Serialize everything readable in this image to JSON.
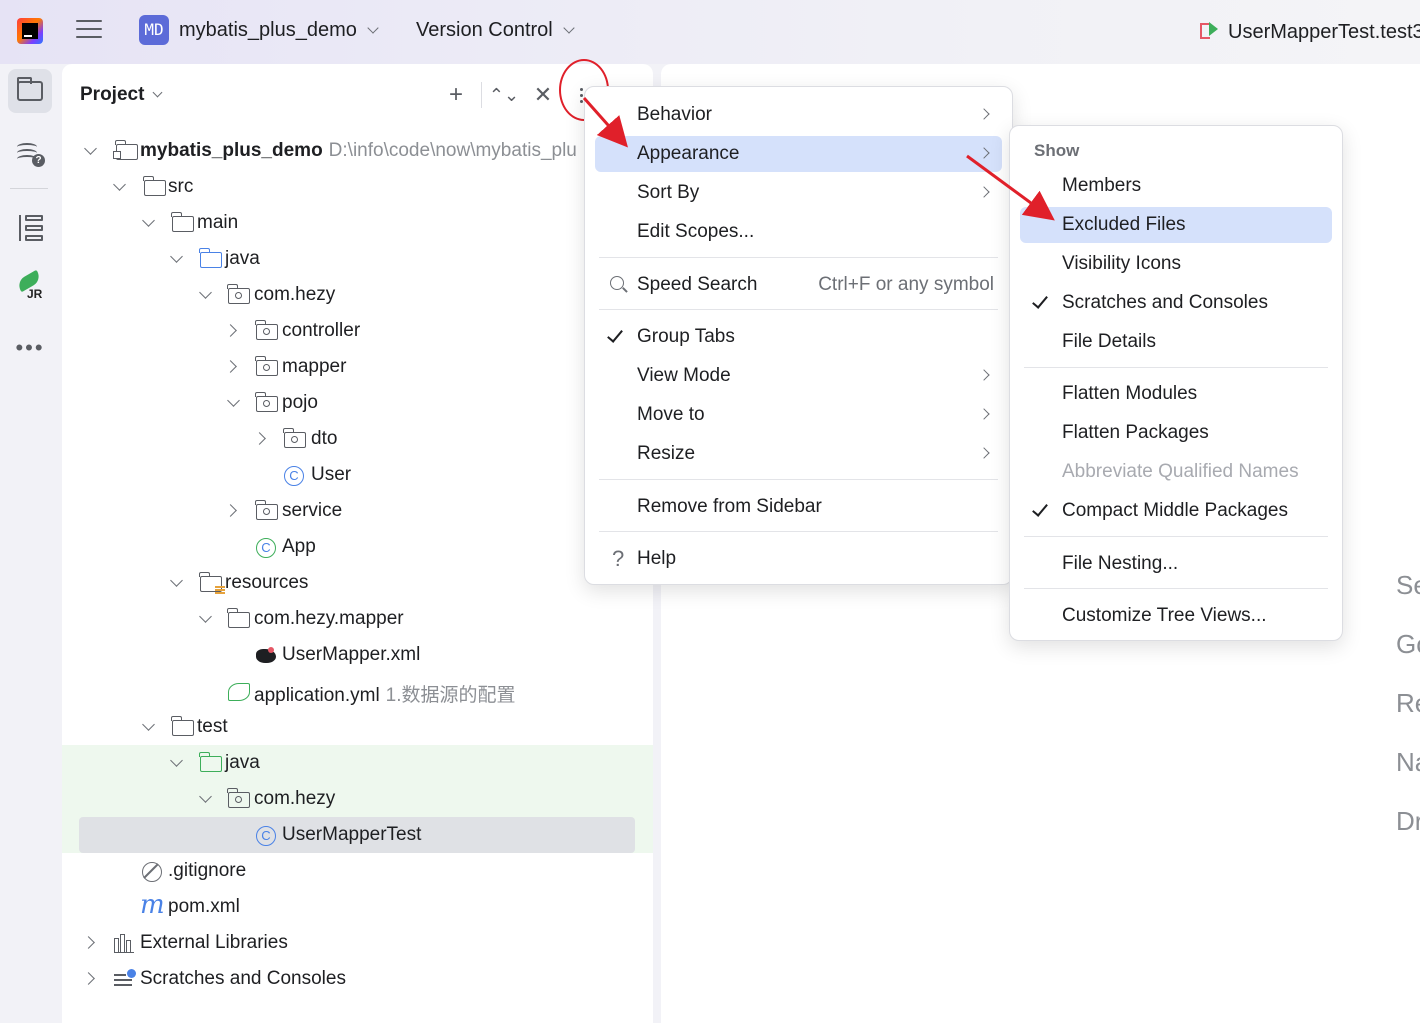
{
  "titlebar": {
    "project_badge": "MD",
    "project_name": "mybatis_plus_demo",
    "vcs_label": "Version Control",
    "run_config": "UserMapperTest.test3"
  },
  "panel": {
    "title": "Project",
    "tree": [
      {
        "label": "mybatis_plus_demo",
        "hint": "D:\\info\\code\\now\\mybatis_plu",
        "icon": "module-folder-icon"
      },
      {
        "label": "src",
        "icon": "folder-icon"
      },
      {
        "label": "main",
        "icon": "folder-icon"
      },
      {
        "label": "java",
        "icon": "source-folder-icon"
      },
      {
        "label": "com.hezy",
        "icon": "package-icon"
      },
      {
        "label": "controller",
        "icon": "package-icon"
      },
      {
        "label": "mapper",
        "icon": "package-icon"
      },
      {
        "label": "pojo",
        "icon": "package-icon"
      },
      {
        "label": "dto",
        "icon": "package-icon"
      },
      {
        "label": "User",
        "icon": "class-icon"
      },
      {
        "label": "service",
        "icon": "package-icon"
      },
      {
        "label": "App",
        "icon": "spring-boot-app-icon"
      },
      {
        "label": "resources",
        "icon": "resources-folder-icon"
      },
      {
        "label": "com.hezy.mapper",
        "icon": "folder-icon"
      },
      {
        "label": "UserMapper.xml",
        "icon": "mybatis-xml-icon"
      },
      {
        "label": "application.yml",
        "hint": "1.数据源的配置",
        "icon": "spring-yml-icon"
      },
      {
        "label": "test",
        "icon": "folder-icon"
      },
      {
        "label": "java",
        "icon": "test-source-folder-icon"
      },
      {
        "label": "com.hezy",
        "icon": "package-icon"
      },
      {
        "label": "UserMapperTest",
        "icon": "test-class-icon"
      },
      {
        "label": ".gitignore",
        "icon": "ignored-file-icon"
      },
      {
        "label": "pom.xml",
        "icon": "maven-icon"
      },
      {
        "label": "External Libraries",
        "icon": "libraries-icon"
      },
      {
        "label": "Scratches and Consoles",
        "icon": "scratches-icon"
      }
    ]
  },
  "menu1": {
    "items": [
      {
        "label": "Behavior"
      },
      {
        "label": "Appearance"
      },
      {
        "label": "Sort By"
      },
      {
        "label": "Edit Scopes..."
      },
      {
        "label": "Speed Search",
        "shortcut": "Ctrl+F or any symbol"
      },
      {
        "label": "Group Tabs",
        "checked": true
      },
      {
        "label": "View Mode"
      },
      {
        "label": "Move to"
      },
      {
        "label": "Resize"
      },
      {
        "label": "Remove from Sidebar"
      },
      {
        "label": "Help"
      }
    ]
  },
  "menu2": {
    "header": "Show",
    "items": [
      {
        "label": "Members"
      },
      {
        "label": "Excluded Files"
      },
      {
        "label": "Visibility Icons"
      },
      {
        "label": "Scratches and Consoles",
        "checked": true
      },
      {
        "label": "File Details"
      },
      {
        "label": "Flatten Modules"
      },
      {
        "label": "Flatten Packages"
      },
      {
        "label": "Abbreviate Qualified Names",
        "disabled": true
      },
      {
        "label": "Compact Middle Packages",
        "checked": true
      },
      {
        "label": "File Nesting..."
      },
      {
        "label": "Customize Tree Views..."
      }
    ]
  },
  "editor": {
    "hints": [
      "Se",
      "Go",
      "Re",
      "Na",
      "Dr"
    ]
  },
  "colors": {
    "accent": "#4a82e6",
    "menu_highlight": "#d5e1fb",
    "annotation": "#e0202a",
    "test_bg": "#eef8ee"
  }
}
